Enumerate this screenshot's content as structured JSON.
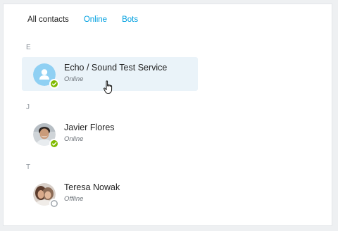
{
  "tabs": [
    {
      "label": "All contacts",
      "active": true
    },
    {
      "label": "Online",
      "active": false
    },
    {
      "label": "Bots",
      "active": false
    }
  ],
  "sections": [
    {
      "letter": "E"
    },
    {
      "letter": "J"
    },
    {
      "letter": "T"
    }
  ],
  "contacts": [
    {
      "name": "Echo / Sound Test Service",
      "status": "Online",
      "presence": "online",
      "selected": true,
      "avatar": "generic-user-icon"
    },
    {
      "name": "Javier Flores",
      "status": "Online",
      "presence": "online",
      "selected": false,
      "avatar": "photo"
    },
    {
      "name": "Teresa Nowak",
      "status": "Offline",
      "presence": "offline",
      "selected": false,
      "avatar": "photo"
    }
  ],
  "colors": {
    "accent": "#00a0e0",
    "online": "#7fba00",
    "selected_bg": "#eaf3f9"
  }
}
